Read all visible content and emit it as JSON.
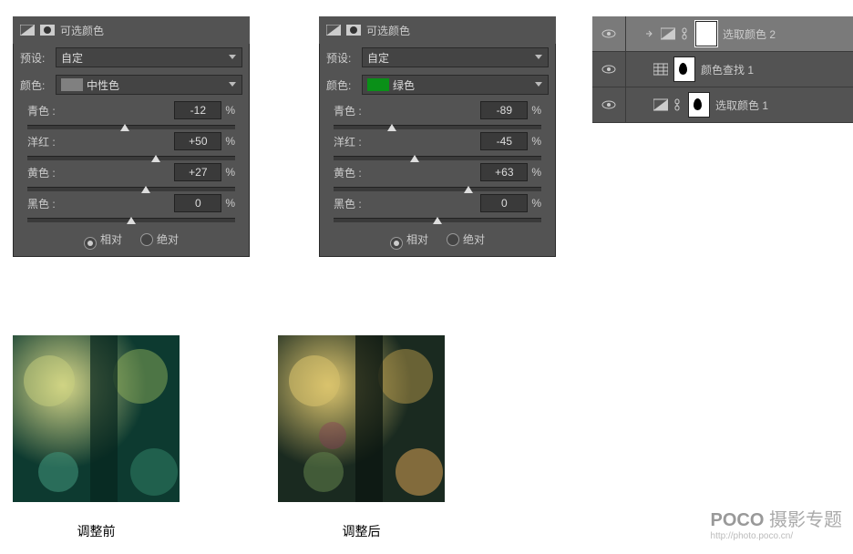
{
  "p1": {
    "title": "可选颜色",
    "preset_lbl": "预设:",
    "preset": "自定",
    "color_lbl": "颜色:",
    "color": "中性色",
    "swatch": "#808080",
    "s": [
      {
        "n": "青色 :",
        "v": "-12",
        "p": 47
      },
      {
        "n": "洋红 :",
        "v": "+50",
        "p": 62
      },
      {
        "n": "黄色 :",
        "v": "+27",
        "p": 57
      },
      {
        "n": "黑色 :",
        "v": "0",
        "p": 50
      }
    ],
    "pct": "%",
    "r1": "相对",
    "r2": "绝对"
  },
  "p2": {
    "title": "可选颜色",
    "preset_lbl": "预设:",
    "preset": "自定",
    "color_lbl": "颜色:",
    "color": "绿色",
    "swatch": "#0a9018",
    "s": [
      {
        "n": "青色 :",
        "v": "-89",
        "p": 28
      },
      {
        "n": "洋红 :",
        "v": "-45",
        "p": 39
      },
      {
        "n": "黄色 :",
        "v": "+63",
        "p": 65
      },
      {
        "n": "黑色 :",
        "v": "0",
        "p": 50
      }
    ],
    "pct": "%",
    "r1": "相对",
    "r2": "绝对"
  },
  "layers": [
    {
      "name": "选取颜色 2",
      "type": "adj"
    },
    {
      "name": "颜色查找 1",
      "type": "lut"
    },
    {
      "name": "选取颜色 1",
      "type": "adj"
    }
  ],
  "img1": "调整前",
  "img2": "调整后",
  "wm1": "POCO",
  "wm2": "摄影专题",
  "wm3": "http://photo.poco.cn/"
}
